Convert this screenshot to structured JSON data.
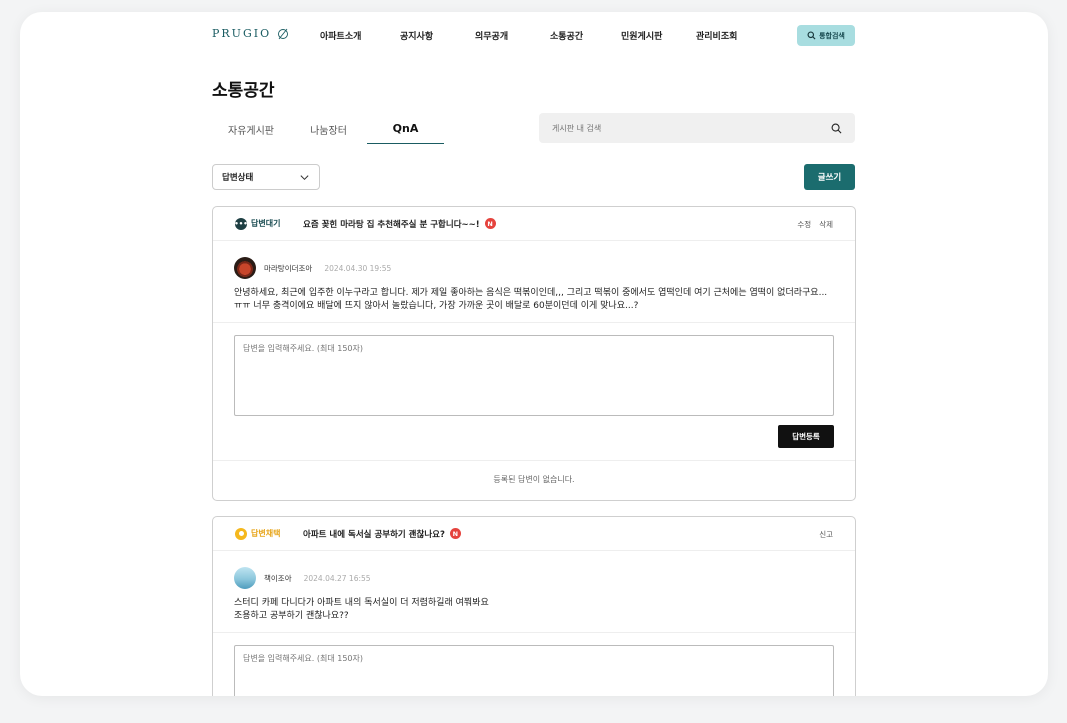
{
  "header": {
    "logo": "PRUGIO",
    "nav": [
      "아파트소개",
      "공지사항",
      "의무공개",
      "소통공간",
      "민원게시판",
      "관리비조회"
    ],
    "search_label": "통합검색"
  },
  "page_title": "소통공간",
  "tabs": [
    "자유게시판",
    "나눔장터",
    "QnA"
  ],
  "active_tab": "QnA",
  "board_search": {
    "placeholder": "게시판 내 검색"
  },
  "filter": {
    "label": "답변상태"
  },
  "write_button": "글쓰기",
  "posts": [
    {
      "status": "답변대기",
      "title": "요즘 꽂힌 마라탕 집 추천해주실 분 구합니다~~!",
      "badge": "N",
      "actions": [
        "수정",
        "삭제"
      ],
      "author": "마라탕이더조아",
      "date": "2024.04.30  19:55",
      "content": "안녕하세요, 최근에 입주한 이누구라고 합니다. 제가 제일 좋아하는 음식은 떡볶이인데,,, 그리고 떡볶이 중에서도 엽떡인데 여기 근처에는 엽떡이 없더라구요... ㅠㅠ 너무 충격이에요 배달에 뜨지 않아서 놀랐습니다, 가장 가까운 곳이 배달로 60분이던데 이게 맞나요...?",
      "answer_placeholder": "답변을 입력해주세요. (최대 150자)",
      "submit_label": "답변등록",
      "empty_text": "등록된 답변이 없습니다."
    },
    {
      "status": "답변채택",
      "title": "아파트 내에 독서실 공부하기 괜찮나요?",
      "badge": "N",
      "actions": [
        "신고"
      ],
      "author": "책이조아",
      "date": "2024.04.27  16:55",
      "content_line1": "스터디 카페 다니다가 아파트 내의 독서실이 더 저렴하길래 여쭤봐요",
      "content_line2": "조용하고 공부하기 괜찮나요??",
      "answer_placeholder": "답변을 입력해주세요. (최대 150자)"
    }
  ],
  "colors": {
    "brand": "#1b6c6e",
    "accent_search": "#a8dde0",
    "chosen": "#f5b81d",
    "new_badge": "#e5433d"
  }
}
